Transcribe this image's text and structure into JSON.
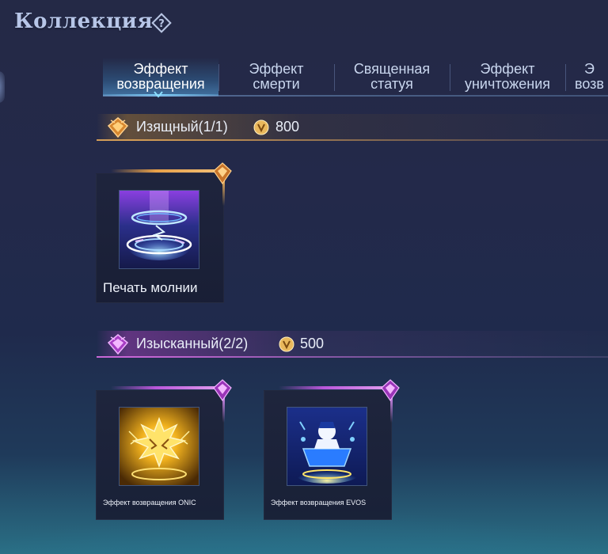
{
  "header": {
    "title": "Коллекция",
    "help_icon": "question-diamond-icon"
  },
  "tabs": [
    {
      "label": "Эффект\nвозвращения",
      "active": true
    },
    {
      "label": "Эффект\nсмерти",
      "active": false
    },
    {
      "label": "Священная\nстатуя",
      "active": false
    },
    {
      "label": "Эффект\nуничтожения",
      "active": false
    },
    {
      "label": "Э\nвозв",
      "active": false
    }
  ],
  "sections": [
    {
      "title": "Изящный(1/1)",
      "points": "800",
      "accent": "#e7a048",
      "items": [
        {
          "name": "Печать молнии",
          "icon": "lightning-seal-thumbnail"
        }
      ]
    },
    {
      "title": "Изысканный(2/2)",
      "points": "500",
      "accent": "#c45ee0",
      "items": [
        {
          "name": "Эффект возвращения ONIC",
          "icon": "onic-recall-thumbnail"
        },
        {
          "name": "Эффект возвращения EVOS",
          "icon": "evos-recall-thumbnail"
        }
      ]
    }
  ],
  "colors": {
    "background_top": "#242946",
    "background_bottom": "#2a6f85",
    "gold_accent": "#e7a048",
    "purple_accent": "#c45ee0",
    "active_tab": "#7fd8ff"
  }
}
